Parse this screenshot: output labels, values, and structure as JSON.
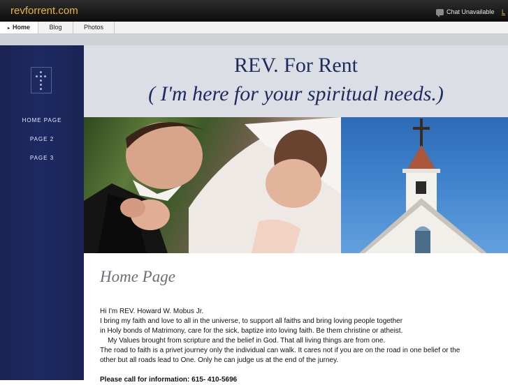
{
  "header": {
    "site_title": "revforrent.com",
    "chat_status": "Chat Unavailable",
    "cut_link": "L"
  },
  "tabs": [
    {
      "label": "Home",
      "active": true
    },
    {
      "label": "Blog",
      "active": false
    },
    {
      "label": "Photos",
      "active": false
    }
  ],
  "sidebar": {
    "items": [
      {
        "label": "HOME PAGE"
      },
      {
        "label": "PAGE 2"
      },
      {
        "label": "PAGE 3"
      }
    ]
  },
  "banner": {
    "title": "REV. For Rent",
    "subtitle": "( I'm here for your spiritual needs.)"
  },
  "main": {
    "heading": "Home Page",
    "lines": [
      "Hi I'm REV. Howard W. Mobus Jr.",
      "I bring my faith and love to all in the universe, to support all faiths and bring loving people together",
      "in Holy bonds of Matrimony, care for the sick, baptize into loving faith. Be them christine or atheist.",
      "    My Values brought from scripture and the belief in God. That all living things are from one.",
      "The road to faith is a privet journey only the individual can walk. It cares not if you are on the road in one belief or the",
      "other but all roads lead to One. Only he can judge us at the end of the jurney."
    ],
    "contact": "Please call for information: 615- 410-5696"
  },
  "colors": {
    "sidebar": "#1d2a62",
    "banner_bg": "#dcdee6",
    "title_text": "#1f2a5e",
    "site_title": "#e8b43a"
  }
}
